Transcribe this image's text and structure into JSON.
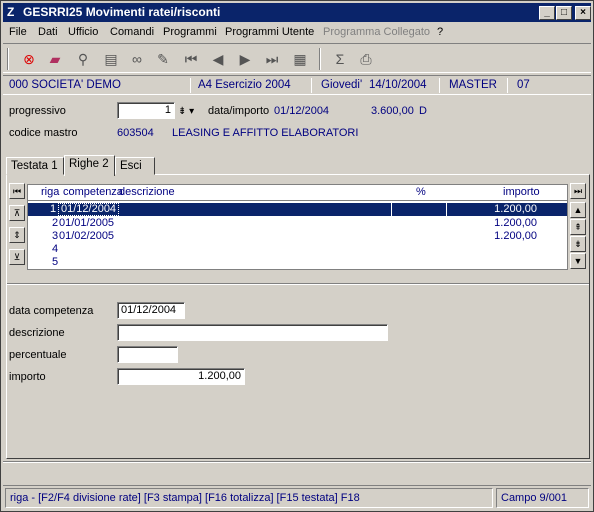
{
  "window": {
    "title": "GESRRI25  Movimenti ratei/risconti",
    "icon": "Z"
  },
  "titlebar_buttons": {
    "minimize": "_",
    "maximize": "□",
    "close": "×"
  },
  "menu": [
    "File",
    "Dati",
    "Ufficio",
    "Comandi",
    "Programmi",
    "Programmi Utente",
    "Programma Collegato",
    "?"
  ],
  "infobar": {
    "company": "000 SOCIETA' DEMO",
    "year": "A4 Esercizio 2004",
    "day": "Giovedi'",
    "date": "14/10/2004",
    "user": "MASTER",
    "code": "07"
  },
  "header": {
    "progressivo_label": "progressivo",
    "progressivo_value": "1",
    "data_importo_label": "data/importo",
    "data_importo_date": "01/12/2004",
    "data_importo_amount": "3.600,00",
    "data_importo_sign": "D",
    "codice_mastro_label": "codice mastro",
    "codice_mastro_value": "603504",
    "codice_mastro_desc": "LEASING E AFFITTO ELABORATORI"
  },
  "tabs": [
    "Testata 1",
    "Righe 2",
    "Esci"
  ],
  "grid": {
    "headers": {
      "riga": "riga",
      "competenza": "competenza",
      "descrizione": "descrizione",
      "percent": "%",
      "importo": "importo"
    },
    "rows": [
      {
        "n": "1",
        "date": "01/12/2004",
        "importo": "1.200,00"
      },
      {
        "n": "2",
        "date": "01/01/2005",
        "importo": "1.200,00"
      },
      {
        "n": "3",
        "date": "01/02/2005",
        "importo": "1.200,00"
      },
      {
        "n": "4",
        "date": "",
        "importo": ""
      },
      {
        "n": "5",
        "date": "",
        "importo": ""
      }
    ]
  },
  "detail": {
    "data_competenza_label": "data competenza",
    "data_competenza_value": "01/12/2004",
    "descrizione_label": "descrizione",
    "descrizione_value": "",
    "percentuale_label": "percentuale",
    "percentuale_value": "",
    "importo_label": "importo",
    "importo_value": "1.200,00"
  },
  "status": {
    "hint": "riga - [F2/F4 divisione rate] [F3 stampa] [F16 totalizza] [F15 testata] F18",
    "campo": "Campo  9/001"
  },
  "colors": {
    "title_bar": "#0a246a",
    "field_text": "#000080",
    "window_bg": "#d4d0c8"
  }
}
